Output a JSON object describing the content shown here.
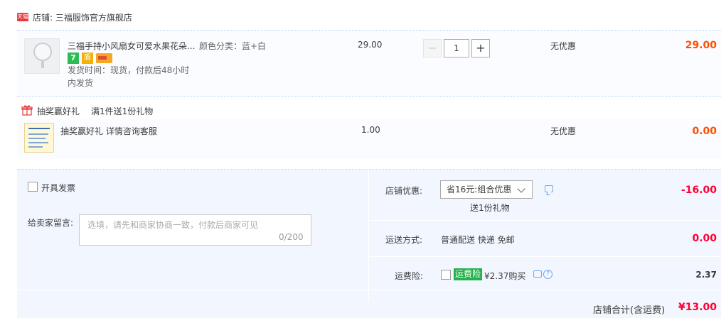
{
  "shop": {
    "badge": "天猫",
    "name": "店铺: 三福服饰官方旗舰店"
  },
  "item1": {
    "image_label": "mini fan",
    "title": "三福手持小风扇女可爱水果花朵...",
    "sku": "颜色分类：蓝+白",
    "service_icons": [
      "7-day-return-icon",
      "shield-icon",
      "credit-card-icon"
    ],
    "service_7": "7",
    "service_shield": "盾",
    "ship_time_line1": "发货时间：现货，付款后48小时",
    "ship_time_line2": "内发货",
    "unit_price": "29.00",
    "qty_minus": "−",
    "qty": "1",
    "qty_plus": "+",
    "promotion": "无优惠",
    "subtotal": "29.00"
  },
  "gift": {
    "label": "抽奖赢好礼",
    "rule": "满1件送1份礼物",
    "name": "抽奖赢好礼 详情咨询客服",
    "unit_price": "1.00",
    "promotion": "无优惠",
    "subtotal": "0.00"
  },
  "invoice": {
    "label": "开具发票",
    "checked": false
  },
  "message": {
    "label": "给卖家留言:",
    "placeholder": "选填，请先和商家协商一致，付款后商家可见",
    "count": "0/200"
  },
  "discount": {
    "label": "店铺优惠:",
    "selected": "省16元:组合优惠",
    "note": "送1份礼物",
    "value": "-16.00"
  },
  "shipping": {
    "label": "运送方式:",
    "method": "普通配送 快递 免邮",
    "value": "0.00"
  },
  "insurance": {
    "label": "运费险:",
    "tag": "运费险",
    "price": "¥2.37购买",
    "help": "?",
    "value": "2.37",
    "checked": false
  },
  "total": {
    "label": "店铺合计(含运费)",
    "value": "¥13.00"
  },
  "colors": {
    "price_orange": "#ff4e00",
    "price_red": "#ff0036",
    "row_bg": "#fbfcff",
    "panel_bg": "#f2f7ff",
    "insurance_green": "#24b24d",
    "tmall_red": "#e4393c"
  }
}
